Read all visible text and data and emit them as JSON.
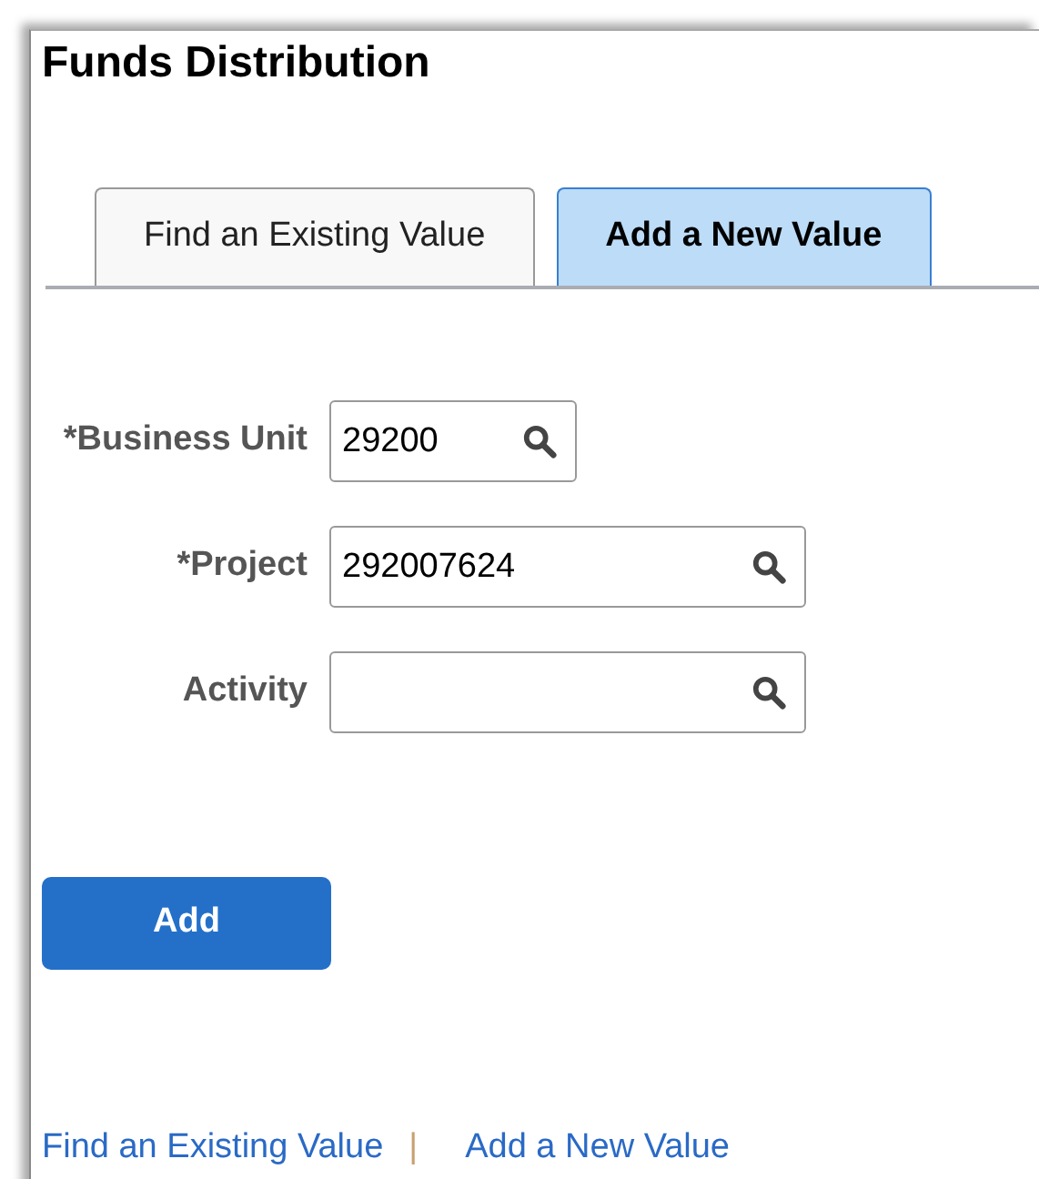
{
  "page": {
    "title": "Funds Distribution"
  },
  "tabs": [
    {
      "label": "Find an Existing Value",
      "selected": false
    },
    {
      "label": "Add a New Value",
      "selected": true
    }
  ],
  "fields": [
    {
      "label": "*Business Unit",
      "value": "29200",
      "kind": "short"
    },
    {
      "label": "*Project",
      "value": "292007624",
      "kind": "long"
    },
    {
      "label": "Activity",
      "kind": "long"
    }
  ],
  "add_button": "Add",
  "footer_links": [
    {
      "label": "Find an Existing Value"
    },
    {
      "separator": "|"
    },
    {
      "label": "Add a New Value"
    }
  ]
}
